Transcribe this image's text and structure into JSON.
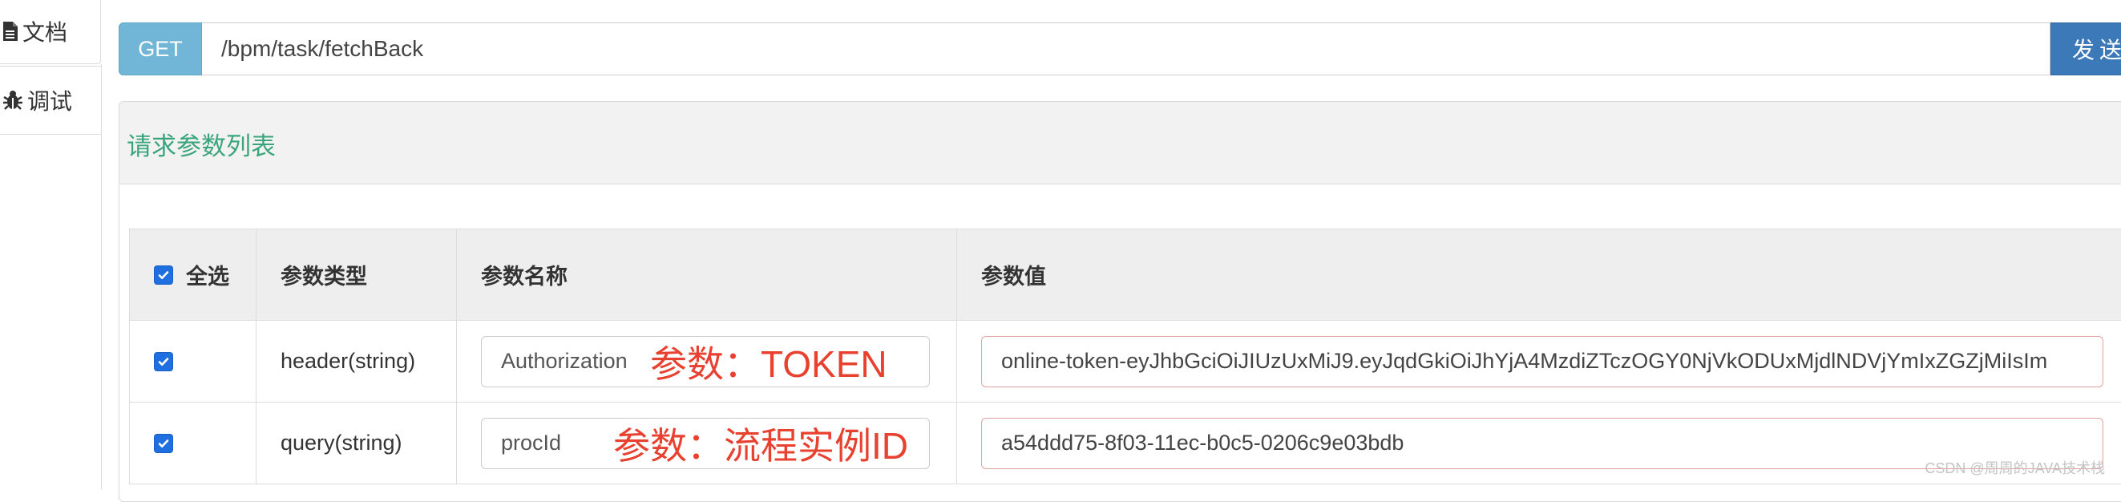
{
  "left_tabs": [
    {
      "label": "文档",
      "icon": "document-icon"
    },
    {
      "label": "调试",
      "icon": "bug-icon"
    }
  ],
  "request": {
    "method": "GET",
    "url": "/bpm/task/fetchBack",
    "send_label": "发送"
  },
  "params_panel": {
    "title": "请求参数列表",
    "headers": {
      "select_all": "全选",
      "param_type": "参数类型",
      "param_name": "参数名称",
      "param_value": "参数值"
    },
    "rows": [
      {
        "checked": true,
        "type": "header(string)",
        "name": "Authorization",
        "annotation": "参数：TOKEN",
        "value": "online-token-eyJhbGciOiJIUzUxMiJ9.eyJqdGkiOiJhYjA4MzdiZTczOGY0NjVkODUxMjdlNDVjYmIxZGZjMiIsIm"
      },
      {
        "checked": true,
        "type": "query(string)",
        "name": "procId",
        "annotation": "参数：流程实例ID",
        "value": "a54ddd75-8f03-11ec-b0c5-0206c9e03bdb"
      }
    ]
  },
  "watermark": "CSDN @周周的JAVA技术栈",
  "colors": {
    "method_badge": "#71b6d6",
    "send_button": "#3c79b8",
    "panel_title": "#3aa57c",
    "annotation": "#e8412f",
    "checkbox": "#1f6fe0"
  }
}
